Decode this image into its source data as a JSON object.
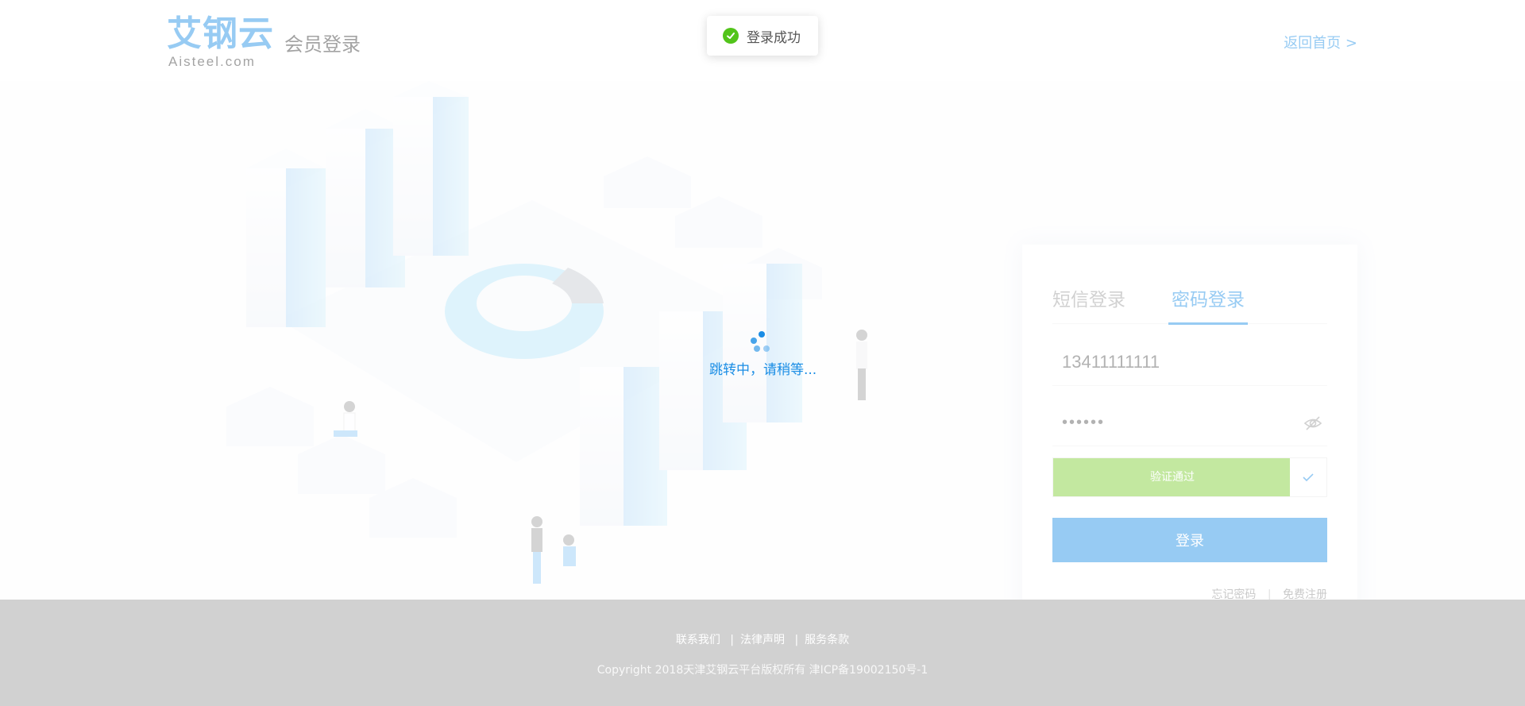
{
  "header": {
    "logo_cn": "艾钢云",
    "logo_en": "Aisteel.com",
    "title": "会员登录",
    "home_link": "返回首页 >"
  },
  "toast": {
    "text": "登录成功",
    "icon": "check-circle-icon",
    "color": "#52c41a"
  },
  "loading": {
    "text": "跳转中，请稍等..."
  },
  "login": {
    "tabs": [
      {
        "label": "短信登录",
        "active": false
      },
      {
        "label": "密码登录",
        "active": true
      }
    ],
    "phone_value": "13411111111",
    "password_value": "••••••",
    "verify_text": "验证通过",
    "submit_label": "登录",
    "forgot_label": "忘记密码",
    "separator": "|",
    "register_label": "免费注册"
  },
  "footer": {
    "links": [
      {
        "label": "联系我们"
      },
      {
        "label": "法律声明"
      },
      {
        "label": "服务条款"
      }
    ],
    "separator": "|",
    "copyright": "Copyright 2018天津艾钢云平台版权所有 津ICP备19002150号-1"
  },
  "colors": {
    "brand": "#1a8de5",
    "verify_success": "#7acc2e",
    "footer_bg": "#9a9a9a"
  }
}
